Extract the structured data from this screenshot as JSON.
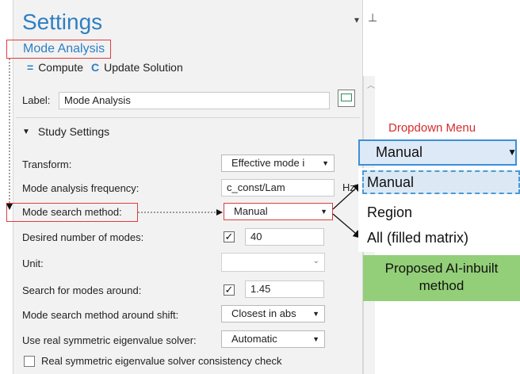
{
  "settings": {
    "title": "Settings",
    "breadcrumb": "Mode Analysis",
    "toolbar": {
      "compute_label": "Compute",
      "update_label": "Update Solution"
    },
    "label_field": {
      "label": "Label:",
      "value": "Mode Analysis"
    },
    "section_title": "Study Settings",
    "rows": {
      "transform": {
        "label": "Transform:",
        "value": "Effective mode i"
      },
      "frequency": {
        "label": "Mode analysis frequency:",
        "value": "c_const/Lam"
      },
      "search_method": {
        "label": "Mode search method:",
        "value": "Manual"
      },
      "desired_modes": {
        "label": "Desired number of modes:",
        "value": "40"
      },
      "unit": {
        "label": "Unit:",
        "value": ""
      },
      "search_around": {
        "label": "Search for modes around:",
        "value": "1.45"
      },
      "around_shift": {
        "label": "Mode search method around shift:",
        "value": "Closest in abs"
      },
      "real_solver": {
        "label": "Use real symmetric eigenvalue solver:",
        "value": "Automatic"
      },
      "consistency": {
        "label": "Real symmetric eigenvalue solver consistency check"
      }
    },
    "hz_label": "Hz"
  },
  "dropdown": {
    "title": "Dropdown Menu",
    "selected": "Manual",
    "options": [
      "Manual",
      "Region",
      "All (filled matrix)"
    ],
    "note": "Proposed AI-inbuilt method"
  },
  "colors": {
    "accent": "#2e7fc1",
    "highlight": "#e23b3b",
    "note_bg": "#93cf78"
  },
  "icons": [
    "compute-icon",
    "update-icon",
    "label-edit-icon",
    "collapse-arrow-icon",
    "pin-icon",
    "dropdown-arrow-icon"
  ]
}
